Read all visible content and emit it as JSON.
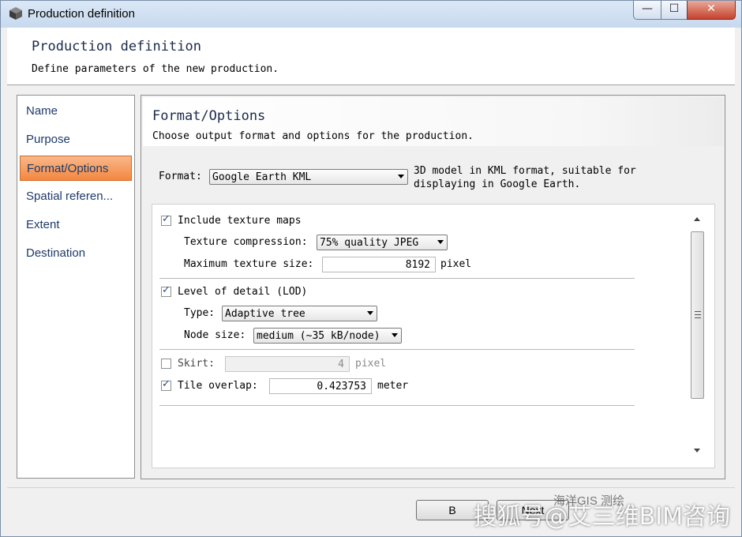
{
  "window": {
    "title": "Production definition",
    "minimize_glyph": "—",
    "maximize_glyph": "☐",
    "close_glyph": "✕"
  },
  "header": {
    "title": "Production definition",
    "subtitle": "Define parameters of the new production."
  },
  "nav": {
    "items": [
      {
        "label": "Name",
        "active": false
      },
      {
        "label": "Purpose",
        "active": false
      },
      {
        "label": "Format/Options",
        "active": true
      },
      {
        "label": "Spatial referen...",
        "active": false
      },
      {
        "label": "Extent",
        "active": false
      },
      {
        "label": "Destination",
        "active": false
      }
    ]
  },
  "content": {
    "title": "Format/Options",
    "subtitle": "Choose output format and options for the production.",
    "format": {
      "label": "Format:",
      "value": "Google Earth KML",
      "description": "3D model in KML format, suitable for displaying in Google Earth."
    },
    "options": {
      "texture": {
        "label": "Include texture maps",
        "checked": true,
        "compression_label": "Texture compression:",
        "compression_value": "75% quality JPEG",
        "max_size_label": "Maximum texture size:",
        "max_size_value": "8192",
        "max_size_unit": "pixel"
      },
      "lod": {
        "label": "Level of detail (LOD)",
        "checked": true,
        "type_label": "Type:",
        "type_value": "Adaptive tree",
        "node_label": "Node size:",
        "node_value": "medium (~35 kB/node)"
      },
      "skirt": {
        "label": "Skirt:",
        "checked": false,
        "value": "4",
        "unit": "pixel"
      },
      "tile_overlap": {
        "label": "Tile overlap:",
        "checked": true,
        "value": "0.423753",
        "unit": "meter"
      }
    }
  },
  "footer": {
    "back_label": "B",
    "next_label": "Next"
  },
  "watermark": {
    "text": "搜狐号@艾三维BIM咨询",
    "faint_text": "海洋GIS   测绘"
  },
  "colors": {
    "active_nav": "#f3873f",
    "nav_text": "#1e3a68",
    "titlebar": "#c7d9ee"
  }
}
